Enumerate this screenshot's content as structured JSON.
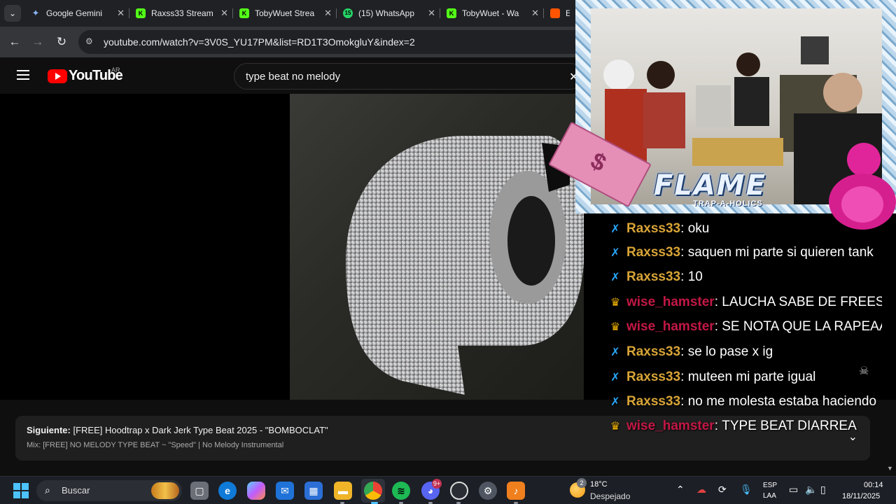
{
  "browser": {
    "tabs": [
      {
        "title": "Google Gemini",
        "favicon": "gemini-icon",
        "color": "#8ab4f8"
      },
      {
        "title": "Raxss33 Stream",
        "favicon": "kick-icon",
        "color": "#53fc18"
      },
      {
        "title": "TobyWuet Strea",
        "favicon": "kick-icon",
        "color": "#53fc18"
      },
      {
        "title": "(15) WhatsApp",
        "favicon": "whatsapp-icon",
        "color": "#25d366",
        "badge": "15"
      },
      {
        "title": "TobyWuet - Wa",
        "favicon": "kick-icon",
        "color": "#53fc18"
      },
      {
        "title": "Esc",
        "favicon": "soundcloud-icon",
        "color": "#ff5500"
      }
    ],
    "url": "youtube.com/watch?v=3V0S_YU17PM&list=RD1T3OmokgluY&index=2"
  },
  "youtube": {
    "logo_text": "YouTube",
    "country": "AR",
    "search_value": "type beat no melody",
    "accent": "#ff0000"
  },
  "upnext": {
    "label": "Siguiente:",
    "title": " [FREE] Hoodtrap x Dark Jerk Type Beat 2025 - \"BOMBOCLAT\"",
    "mix": "Mix: [FREE] NO MELODY TYPE BEAT ~ \"Speed\" | No Melody Instrumental"
  },
  "overlay": {
    "brand": "FLAME",
    "brand_sub": "TRAP-A-HOLICS"
  },
  "chat": {
    "messages": [
      {
        "badge": "sword",
        "user": "Raxss33",
        "text": "oku"
      },
      {
        "badge": "sword",
        "user": "Raxss33",
        "text": "saquen mi parte si quieren tank"
      },
      {
        "badge": "sword",
        "user": "Raxss33",
        "text": "10"
      },
      {
        "badge": "crown",
        "user": "wise_hamster",
        "text": "LAUCHA SABE DE FREEST"
      },
      {
        "badge": "crown",
        "user": "wise_hamster",
        "text": "SE NOTA QUE LA RAPEAA"
      },
      {
        "badge": "sword",
        "user": "Raxss33",
        "text": "se lo pase x ig"
      },
      {
        "badge": "sword",
        "user": "Raxss33",
        "text": "muteen mi parte igual"
      },
      {
        "badge": "sword",
        "user": "Raxss33",
        "text": "no me molesta estaba haciendo"
      },
      {
        "badge": "crown",
        "user": "wise_hamster",
        "text": "TYPE BEAT DIARREA"
      }
    ],
    "colors": {
      "raxss": "#d8a437",
      "hamster": "#c21845",
      "sword": "#29a9ff",
      "crown": "#f4b400"
    }
  },
  "taskbar": {
    "search_placeholder": "Buscar",
    "weather_temp": "18°C",
    "weather_desc": "Despejado",
    "weather_badge": "2",
    "discord_badge": "9+",
    "lang_top": "ESP",
    "lang_bottom": "LAA",
    "time": "00:14",
    "date": "18/11/2025"
  }
}
